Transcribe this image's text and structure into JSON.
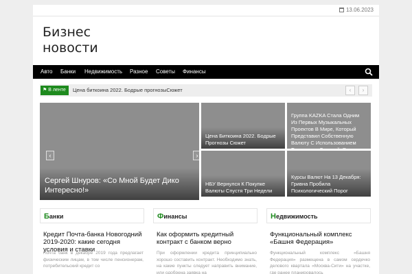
{
  "topbar": {
    "date": "13.06.2023"
  },
  "site": {
    "title_line1": "Бизнес",
    "title_line2": "новости"
  },
  "nav": {
    "items": [
      "Авто",
      "Банки",
      "Недвижимость",
      "Разное",
      "Советы",
      "Финансы"
    ]
  },
  "ticker": {
    "label": "В ленте",
    "text": "Цена биткоина 2022. Бодрые прогнозыСюжет",
    "prev": "‹",
    "next": "›"
  },
  "featured": {
    "main": {
      "title": "Сергей Шнуров: «Со Мной Будет Дико Интересно!»",
      "prev": "‹",
      "next": "›"
    },
    "tiles": [
      {
        "title": "Цена Биткоина 2022. Бодрые Прогнозы Сюжет"
      },
      {
        "title": "Группа KAZKA Стала Одним Из Первых Музыкальных Проектов В Мире, Который Представил Собственную Валюту С Использованием Технологии БлокчейнРеклама"
      },
      {
        "title": "НБУ Вернулся К Покупке Валюты Спустя Три Недели"
      },
      {
        "title": "Курсы Валют На 13 Декабря: Гривна Пробила Психологический Порог"
      }
    ]
  },
  "columns": [
    {
      "head_first": "Б",
      "head_rest": "анки",
      "title": "Кредит Почта-банка Новогодний 2019-2020: какие сегодня условия и ставки",
      "excerpt": "Почта банк в декабре 2019 года предлагает физическим лицам, в том числе пенсионерам, потребительский кредит со"
    },
    {
      "head_first": "Ф",
      "head_rest": "инансы",
      "title": "Как оформить кредитный контракт с банком верно",
      "excerpt": "При оформлении кредита принципиально хорошо составить контракт. Необходимо знать, на какие пункты следует направить внимание, или одобрена заявка на"
    },
    {
      "head_first": "Н",
      "head_rest": "едвижимость",
      "title": "Функциональный комплекс «Башня Федерация»",
      "excerpt": "Функциональный комплекс «Башня Федерация» размещена в самом сердечко делового квартала «Москва-Сити» на участке, где ранее планировалось"
    }
  ],
  "colors": {
    "accent": "#1e8a1e",
    "nav_bg": "#000000",
    "tile_bg": "#8e8e8e"
  }
}
